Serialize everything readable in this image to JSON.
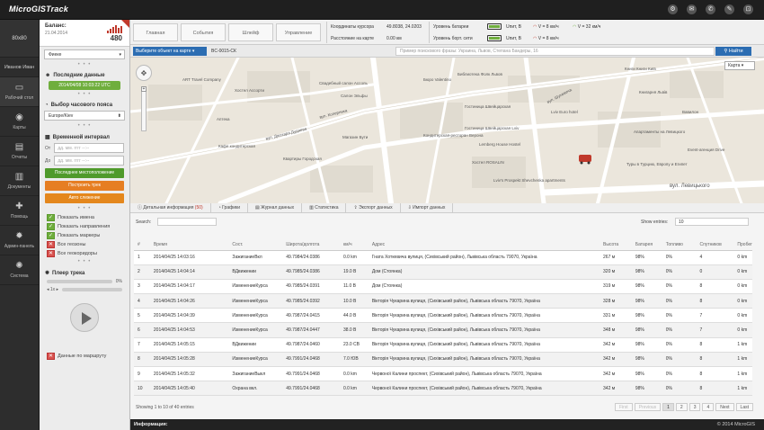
{
  "app": {
    "title": "MicroGISTrack"
  },
  "nav": {
    "avatar": "80x80",
    "user": "Иванов Иван",
    "items": [
      {
        "label": "Рабочий стол",
        "icon": "monitor-icon"
      },
      {
        "label": "Карты",
        "icon": "globe-icon"
      },
      {
        "label": "Отчеты",
        "icon": "report-icon"
      },
      {
        "label": "Документы",
        "icon": "documents-icon"
      },
      {
        "label": "Помощь",
        "icon": "help-icon"
      },
      {
        "label": "Админ-панель",
        "icon": "gear-icon"
      },
      {
        "label": "Система",
        "icon": "system-gear-icon"
      }
    ]
  },
  "sidebar": {
    "balance_label": "Баланс:",
    "balance_date": "21.04.2014",
    "balance_amount": "480",
    "object_select": "Фиеке",
    "last_data_title": "Последние данные",
    "last_data_value": "2014/04/08 10:03:22 UTC",
    "tz_title": "Выбор часового пояса",
    "tz_value": "Europe/Kiev",
    "interval_title": "Временной интервал",
    "from_label": "От",
    "to_label": "До",
    "from_placeholder": "дд. мм. гггг --:--",
    "to_placeholder": "дд. мм. гггг --:--",
    "btn_last": "Последнее местоположение",
    "btn_track": "Построить трек",
    "btn_auto": "Авто слежение",
    "options": [
      {
        "label": "Показать имена",
        "on": true
      },
      {
        "label": "Показать направления",
        "on": true
      },
      {
        "label": "Показать маркеры",
        "on": true
      },
      {
        "label": "Все геозоны",
        "on": false
      },
      {
        "label": "Все геокоридоры",
        "on": false
      }
    ],
    "player_title": "Плеер трека",
    "player_progress": "0%",
    "player_speed": "1x",
    "route_data_label": "Данные по маршруту"
  },
  "toolbar": {
    "buttons": [
      "Главная",
      "События",
      "Шлейф",
      "Управление"
    ],
    "coords_label": "Координаты курсора",
    "coords_value": "49.8038, 24.0203",
    "distance_label": "Расстояние на карте",
    "distance_value": "0.00 км",
    "battery_label": "Уровень батареи",
    "board_label": "Уровень борт. сети",
    "battery_volt": "Uпит, B",
    "board_volt": "Uпит, B",
    "speed1": "V = 8 км/ч",
    "speed2": "V = 8 км/ч",
    "speed3": "V = 32 км/ч"
  },
  "search": {
    "select_object": "Выберите объект на карте",
    "object_name": "BC-0015-СК",
    "placeholder": "Пример поискового фразы: Украина, Львов, Степана Бандеры, 16",
    "search_button": "Найти"
  },
  "map": {
    "type": "Карта",
    "labels": [
      "ART Travel Company",
      "Хостел Ассорти",
      "Свадебный салон Ассоль",
      "Салон Эльфы",
      "Аптека",
      "Бюро Valentino",
      "Библиотека Фолк Львов",
      "Гостиница Швейцарская",
      "Гостиница Швейцарская Lviv",
      "Lemberg House Hostel",
      "Кондитерская-ресторан Верона",
      "Хостел ROSALIN",
      "Lviv's Prospekt Shevchenka apartments",
      "Магазин Бути",
      "Квартиры Городская",
      "Кафе кондитерская",
      "Книги Книги Київ",
      "Книгарня Львів",
      "Lviv Euro hotel",
      "Апартаменты на Левицкого",
      "Event-агенция Drive",
      "Туры в Турцию, Европу и Египет",
      "Вавилон",
      "вул. Джохара Дудаева",
      "вул. Левицького",
      "вул. Коперника",
      "вул. Шухевича"
    ]
  },
  "tabs": [
    {
      "label": "Детальная информация",
      "count": "(50)"
    },
    {
      "label": "Графики",
      "count": ""
    },
    {
      "label": "Журнал данных",
      "count": ""
    },
    {
      "label": "Статистика",
      "count": ""
    },
    {
      "label": "Экспорт данных",
      "count": ""
    },
    {
      "label": "Импорт данных",
      "count": ""
    }
  ],
  "table_controls": {
    "search_label": "Search:",
    "show_label": "Show entries:",
    "show_value": "10"
  },
  "table": {
    "headers": [
      "#",
      "Время",
      "Сост.",
      "Широта/долгота",
      "км/ч",
      "Адрес",
      "Высота",
      "Батарея",
      "Топливо",
      "Спутников",
      "Пробег"
    ],
    "rows": [
      [
        "1",
        "2014/04/25 14:03:16",
        "ЗажиганиеВкл",
        "49.7984/24.0386",
        "0.0 km",
        "Гната Хоткевича вулиця, (Сихівський район), Львівська область 79070, Україна",
        "267 м",
        "98%",
        "0%",
        "4",
        "0 km"
      ],
      [
        "2",
        "2014/04/25 14:04:14",
        "ВДвижении",
        "49.7985/24.0386",
        "19.0 В",
        "Дом (Стоянка)",
        "320 м",
        "98%",
        "0%",
        "0",
        "0 km"
      ],
      [
        "3",
        "2014/04/25 14:04:17",
        "ИзменениеКурса",
        "49.7985/24.0391",
        "11.0 В",
        "Дом (Стоянка)",
        "319 м",
        "98%",
        "0%",
        "8",
        "0 km"
      ],
      [
        "4",
        "2014/04/25 14:04:26",
        "ИзменениеКурса",
        "49.7985/24.0392",
        "10.0 В",
        "Вікторія Чукарина вулиця, (Сихівський район), Львівська область 79070, Україна",
        "328 м",
        "98%",
        "0%",
        "8",
        "0 km"
      ],
      [
        "5",
        "2014/04/25 14:04:39",
        "ИзменениеКурса",
        "49.7987/24.0415",
        "44.0 В",
        "Вікторія Чукарина вулиця, (Сихівський район), Львівська область 79070, Україна",
        "331 м",
        "98%",
        "0%",
        "7",
        "0 km"
      ],
      [
        "6",
        "2014/04/25 14:04:53",
        "ИзменениеКурса",
        "49.7987/24.0447",
        "38.0 В",
        "Вікторія Чукарина вулиця, (Сихівський район), Львівська область 79070, Україна",
        "348 м",
        "98%",
        "0%",
        "7",
        "0 km"
      ],
      [
        "7",
        "2014/04/25 14:05:15",
        "ВДвижении",
        "49.7987/24.0460",
        "23.0 СВ",
        "Вікторія Чукарина вулиця, (Сихівський район), Львівська область 79070, Україна",
        "342 м",
        "98%",
        "0%",
        "8",
        "1 km"
      ],
      [
        "8",
        "2014/04/25 14:05:28",
        "ИзменениеКурса",
        "49.7991/24.0468",
        "7.0 ЮВ",
        "Вікторія Чукарина вулиця, (Сихівський район), Львівська область 79070, Україна",
        "342 м",
        "98%",
        "0%",
        "8",
        "1 km"
      ],
      [
        "9",
        "2014/04/25 14:05:32",
        "ЗажиганиеВыкл",
        "49.7991/24.0468",
        "0.0 km",
        "Червоної Калини проспект, (Сихівський район), Львівська область 79070, Україна",
        "342 м",
        "98%",
        "0%",
        "8",
        "1 km"
      ],
      [
        "10",
        "2014/04/25 14:05:40",
        "Охрана вкл.",
        "49.7991/24.0468",
        "0.0 km",
        "Червоної Калини проспект, (Сихівський район), Львівська область 79070, Україна",
        "342 м",
        "98%",
        "0%",
        "8",
        "1 km"
      ]
    ]
  },
  "pagination": {
    "showing": "Showing 1 to 10 of 40 entries",
    "buttons": [
      "First",
      "Previous",
      "1",
      "2",
      "3",
      "4",
      "Next",
      "Last"
    ]
  },
  "footer": {
    "left": "Информация:",
    "right": "© 2014 MicroGIS"
  }
}
